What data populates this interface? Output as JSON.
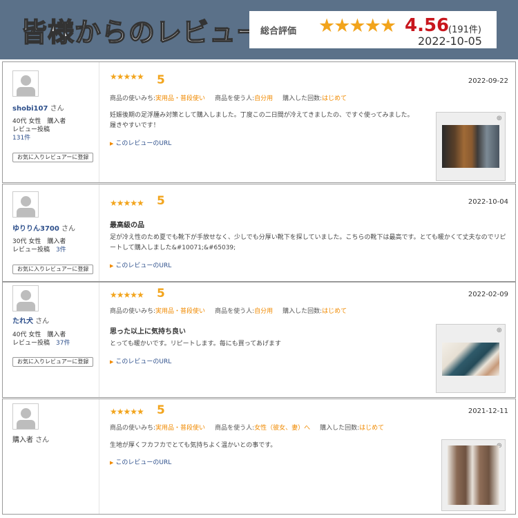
{
  "header": {
    "title": "皆様からのレビュー",
    "rating_label": "総合評価",
    "stars": "★★★★★",
    "score": "4.56",
    "count": "(191件)",
    "date": "2022-10-05"
  },
  "labels": {
    "usage": "商品の使いみち:",
    "user": "商品を使う人:",
    "times": "購入した回数:",
    "url": "このレビューのURL",
    "fav": "お気に入りレビュアーに登録",
    "san": "さん",
    "posts": "レビュー投稿"
  },
  "reviews": [
    {
      "name": "shobi107",
      "profile": "40代 女性　購入者",
      "posts_count": "131件",
      "stars": "★★★★★",
      "score": "5",
      "date": "2022-09-22",
      "usage": "実用品・普段使い",
      "user": "自分用",
      "times": "はじめて",
      "title": "",
      "body": "妊娠後期の足浮腫み対策として購入しました。丁度この二日間が冷えてきましたの、ですぐ使ってみました。履きやすいです！"
    },
    {
      "name": "ゆりりん3700",
      "profile": "30代 女性　購入者",
      "posts_count": "3件",
      "stars": "★★★★★",
      "score": "5",
      "date": "2022-10-04",
      "usage": "",
      "user": "",
      "times": "",
      "title": "最高級の品",
      "body": "足が冷え性のため夏でも靴下が手放せなく、少しでも分厚い靴下を探していました。こちらの靴下は最高です。とても暖かくて丈夫なのでリピートして購入しました&#10071;&#65039;"
    },
    {
      "name": "たれ犬",
      "profile": "40代 女性　購入者",
      "posts_count": "37件",
      "stars": "★★★★★",
      "score": "5",
      "date": "2022-02-09",
      "usage": "実用品・普段使い",
      "user": "自分用",
      "times": "はじめて",
      "title": "思った以上に気持ち良い",
      "body": "とっても暖かいです。リピートします。毎にも買ってあげます"
    },
    {
      "name": "購入者",
      "profile": "",
      "posts_count": "",
      "stars": "★★★★★",
      "score": "5",
      "date": "2021-12-11",
      "usage": "実用品・普段使い",
      "user": "女性（彼女、妻）へ",
      "times": "はじめて",
      "title": "",
      "body": "生地が厚くフカフカでとても気持ちよく温かいとの事です。"
    }
  ]
}
